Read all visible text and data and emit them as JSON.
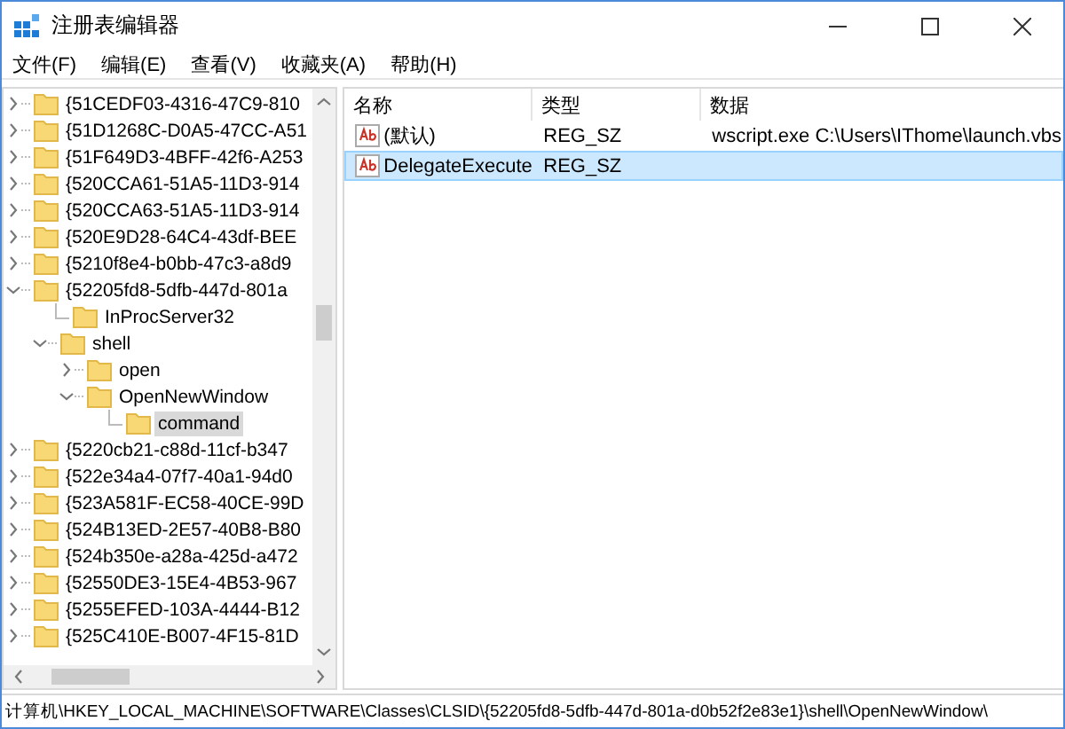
{
  "window": {
    "title": "注册表编辑器"
  },
  "menu": [
    {
      "label": "文件(F)"
    },
    {
      "label": "编辑(E)"
    },
    {
      "label": "查看(V)"
    },
    {
      "label": "收藏夹(A)"
    },
    {
      "label": "帮助(H)"
    }
  ],
  "tree": [
    {
      "label": "{51CEDF03-4316-47C9-810",
      "kind": "folder",
      "expanded": false,
      "selected": false
    },
    {
      "label": "{51D1268C-D0A5-47CC-A51",
      "kind": "folder",
      "expanded": false,
      "selected": false
    },
    {
      "label": "{51F649D3-4BFF-42f6-A253",
      "kind": "folder",
      "expanded": false,
      "selected": false
    },
    {
      "label": "{520CCA61-51A5-11D3-914",
      "kind": "folder",
      "expanded": false,
      "selected": false
    },
    {
      "label": "{520CCA63-51A5-11D3-914",
      "kind": "folder",
      "expanded": false,
      "selected": false
    },
    {
      "label": "{520E9D28-64C4-43df-BEE",
      "kind": "folder",
      "expanded": false,
      "selected": false
    },
    {
      "label": "{5210f8e4-b0bb-47c3-a8d9",
      "kind": "folder",
      "expanded": false,
      "selected": false
    },
    {
      "label": "{52205fd8-5dfb-447d-801a",
      "kind": "folder",
      "expanded": true,
      "selected": false,
      "children": [
        {
          "label": "InProcServer32",
          "kind": "leaf",
          "selected": false
        },
        {
          "label": "shell",
          "kind": "folder",
          "expanded": true,
          "selected": false,
          "children": [
            {
              "label": "open",
              "kind": "folder",
              "expanded": false,
              "selected": false
            },
            {
              "label": "OpenNewWindow",
              "kind": "folder",
              "expanded": true,
              "selected": false,
              "children": [
                {
                  "label": "command",
                  "kind": "leaf",
                  "selected": true
                }
              ]
            }
          ]
        }
      ]
    },
    {
      "label": "{5220cb21-c88d-11cf-b347",
      "kind": "folder",
      "expanded": false,
      "selected": false
    },
    {
      "label": "{522e34a4-07f7-40a1-94d0",
      "kind": "folder",
      "expanded": false,
      "selected": false
    },
    {
      "label": "{523A581F-EC58-40CE-99D",
      "kind": "folder",
      "expanded": false,
      "selected": false
    },
    {
      "label": "{524B13ED-2E57-40B8-B80",
      "kind": "folder",
      "expanded": false,
      "selected": false
    },
    {
      "label": "{524b350e-a28a-425d-a472",
      "kind": "folder",
      "expanded": false,
      "selected": false
    },
    {
      "label": "{52550DE3-15E4-4B53-967",
      "kind": "folder",
      "expanded": false,
      "selected": false
    },
    {
      "label": "{5255EFED-103A-4444-B12",
      "kind": "folder",
      "expanded": false,
      "selected": false
    },
    {
      "label": "{525C410E-B007-4F15-81D",
      "kind": "folder",
      "expanded": false,
      "selected": false
    }
  ],
  "values": {
    "columns": [
      "名称",
      "类型",
      "数据"
    ],
    "rows": [
      {
        "name": "(默认)",
        "type": "REG_SZ",
        "data": "wscript.exe C:\\Users\\IThome\\launch.vbs",
        "selected": false
      },
      {
        "name": "DelegateExecute",
        "type": "REG_SZ",
        "selected": true
      }
    ]
  },
  "status_bar": "计算机\\HKEY_LOCAL_MACHINE\\SOFTWARE\\Classes\\CLSID\\{52205fd8-5dfb-447d-801a-d0b52f2e83e1}\\shell\\OpenNewWindow\\"
}
